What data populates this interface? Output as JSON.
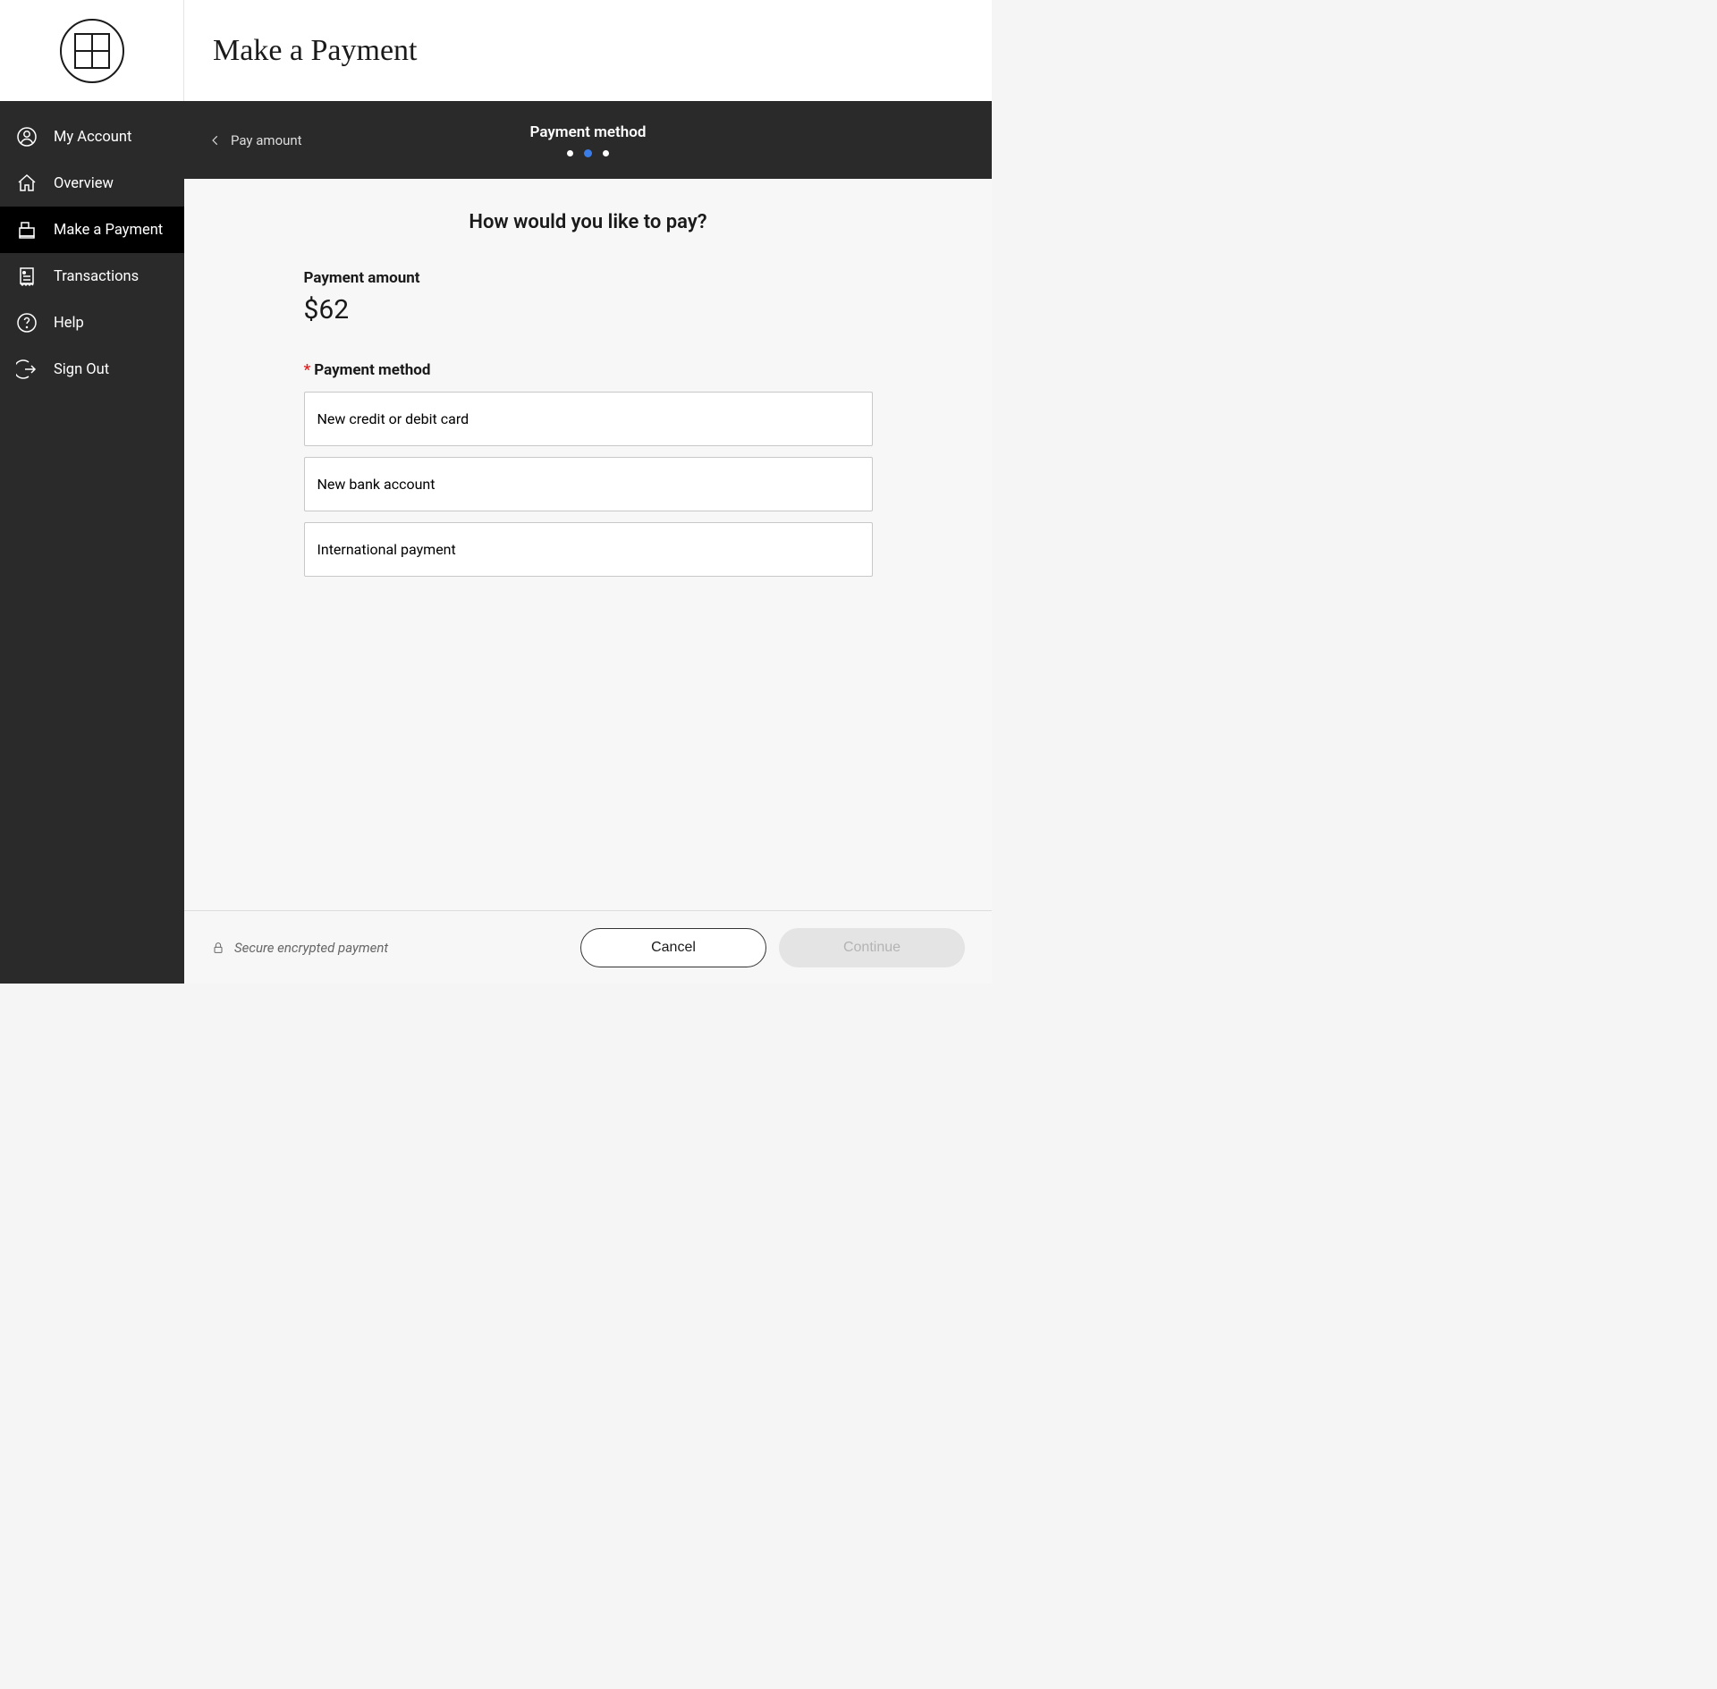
{
  "header": {
    "title": "Make a Payment"
  },
  "sidebar": {
    "items": [
      {
        "label": "My Account"
      },
      {
        "label": "Overview"
      },
      {
        "label": "Make a Payment"
      },
      {
        "label": "Transactions"
      },
      {
        "label": "Help"
      },
      {
        "label": "Sign Out"
      }
    ],
    "active_index": 2
  },
  "stepper": {
    "back_label": "Pay amount",
    "current_label": "Payment method",
    "total_steps": 3,
    "current_step": 2
  },
  "main": {
    "question": "How would you like to pay?",
    "amount_label": "Payment amount",
    "amount_value": "$62",
    "method_label": "Payment method",
    "required_mark": "*",
    "method_options": [
      {
        "label": "New credit or debit card"
      },
      {
        "label": "New bank account"
      },
      {
        "label": "International payment"
      }
    ]
  },
  "footer": {
    "secure_text": "Secure encrypted payment",
    "cancel_label": "Cancel",
    "continue_label": "Continue",
    "continue_enabled": false
  }
}
